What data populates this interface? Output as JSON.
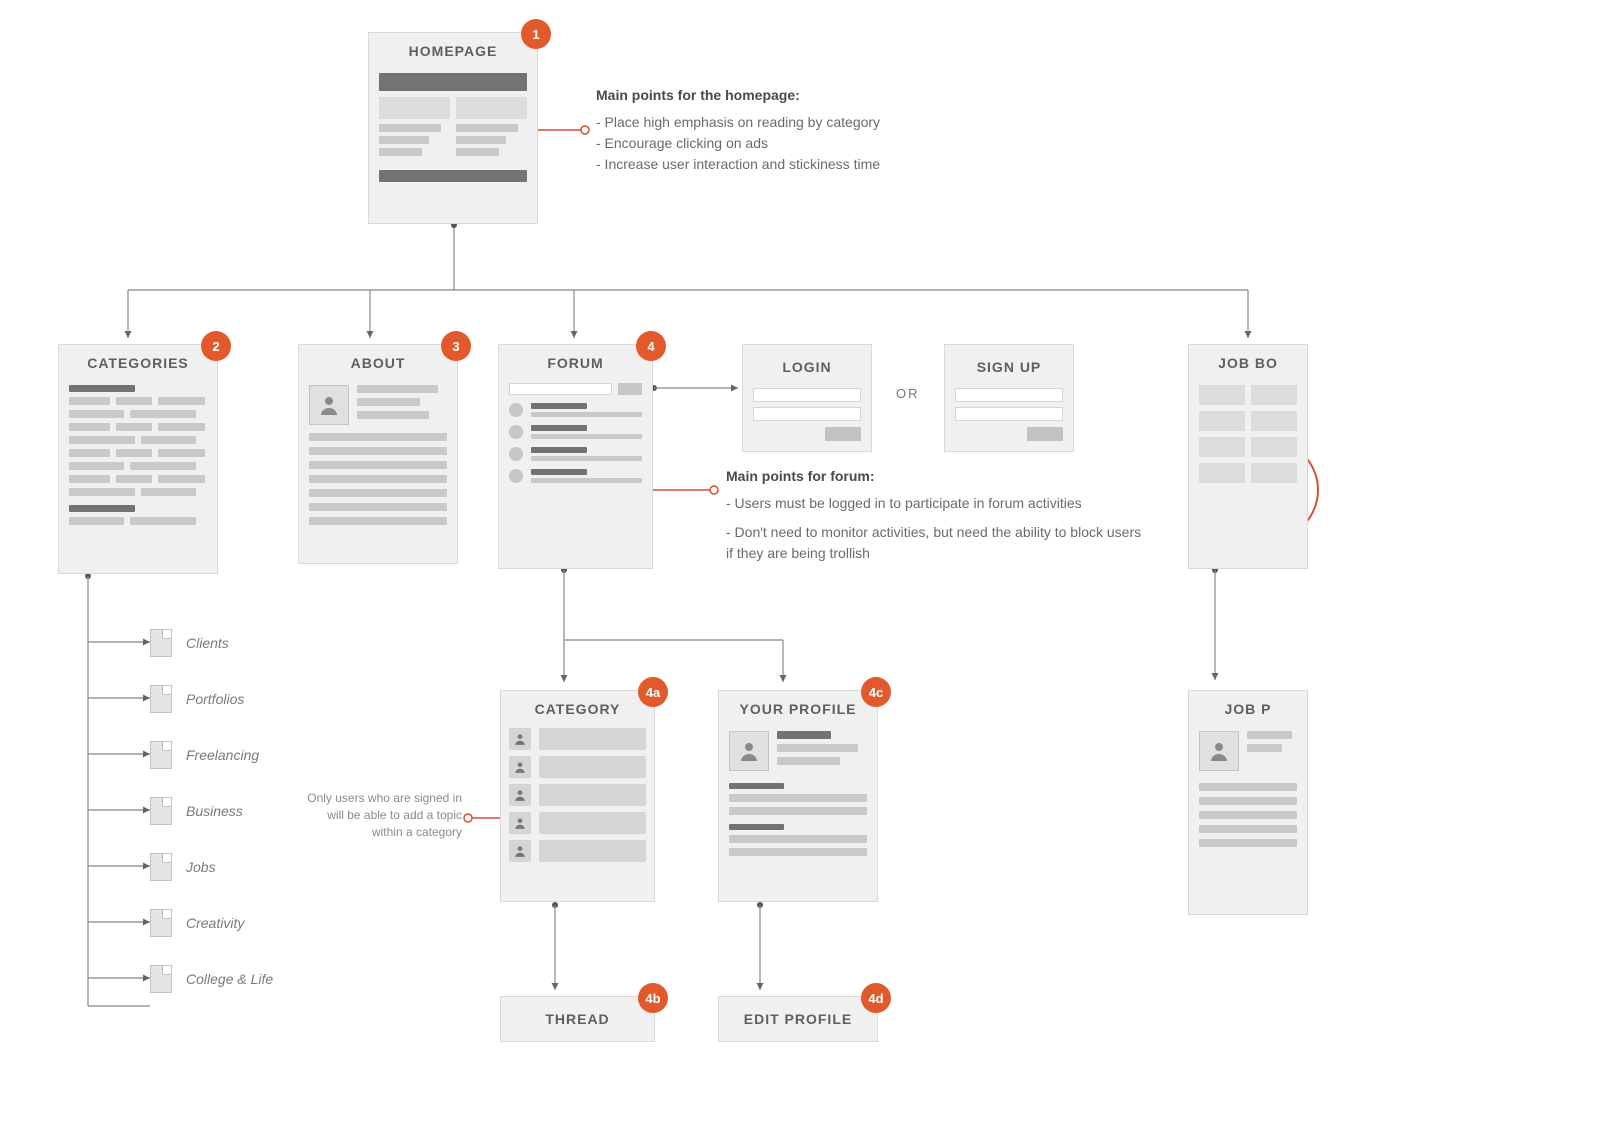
{
  "nodes": {
    "homepage": {
      "title": "HOMEPAGE",
      "badge": "1"
    },
    "categories": {
      "title": "CATEGORIES",
      "badge": "2"
    },
    "about": {
      "title": "ABOUT",
      "badge": "3"
    },
    "forum": {
      "title": "FORUM",
      "badge": "4"
    },
    "login": {
      "title": "LOGIN"
    },
    "signup": {
      "title": "SIGN UP"
    },
    "jobboard": {
      "title": "JOB BO"
    },
    "category": {
      "title": "CATEGORY",
      "badge": "4a"
    },
    "profile": {
      "title": "YOUR PROFILE",
      "badge": "4c"
    },
    "jobp": {
      "title": "JOB P"
    },
    "thread": {
      "title": "THREAD",
      "badge": "4b"
    },
    "editprofile": {
      "title": "EDIT PROFILE",
      "badge": "4d"
    }
  },
  "or_label": "OR",
  "callouts": {
    "homepage": {
      "heading": "Main points for the homepage:",
      "lines": [
        "- Place high emphasis on reading by category",
        "- Encourage clicking on ads",
        "- Increase user interaction and stickiness time"
      ]
    },
    "forum": {
      "heading": "Main points for forum:",
      "lines": [
        "- Users must be logged in to participate in forum activities",
        "- Don't need to monitor activities, but need the ability to block users if they are being trollish"
      ]
    },
    "category_note": {
      "lines": [
        "Only users who are signed in",
        "will be able to add a topic",
        "within a category"
      ]
    }
  },
  "category_items": [
    "Clients",
    "Portfolios",
    "Freelancing",
    "Business",
    "Jobs",
    "Creativity",
    "College & Life"
  ]
}
